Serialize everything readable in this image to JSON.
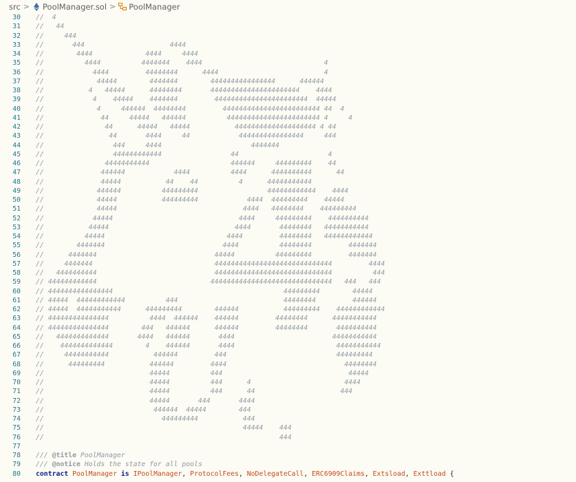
{
  "breadcrumb": {
    "root": "src",
    "file": "PoolManager.sol",
    "symbol": "PoolManager",
    "icons": {
      "file": "ethereum-icon",
      "symbol": "symbol-class-icon"
    }
  },
  "art_lines": [
    {
      "n": "30",
      "t": "//  4"
    },
    {
      "n": "31",
      "t": "//   44"
    },
    {
      "n": "32",
      "t": "//     444"
    },
    {
      "n": "33",
      "t": "//       444                     4444"
    },
    {
      "n": "34",
      "t": "//        4444             4444     4444"
    },
    {
      "n": "35",
      "t": "//          4444          4444444    4444                              4"
    },
    {
      "n": "36",
      "t": "//            4444         44444444      4444                          4"
    },
    {
      "n": "37",
      "t": "//             44444        4444444        4444444444444444      444444"
    },
    {
      "n": "38",
      "t": "//           4   44444      44444444       4444444444444444444444    4444"
    },
    {
      "n": "39",
      "t": "//            4    44444    4444444         44444444444444444444444  44444"
    },
    {
      "n": "40",
      "t": "//             4     444444  44444444         444444444444444444444444 44  4"
    },
    {
      "n": "41",
      "t": "//              44     44444   444444          44444444444444444444444 4     4"
    },
    {
      "n": "42",
      "t": "//               44      44444   44444           44444444444444444444 4 44"
    },
    {
      "n": "43",
      "t": "//                44       4444     44            4444444444444444     444"
    },
    {
      "n": "44",
      "t": "//                 444     4444                      4444444"
    },
    {
      "n": "45",
      "t": "//                 444444444444                 44                      4"
    },
    {
      "n": "46",
      "t": "//               44444444444                    444444     444444444    44"
    },
    {
      "n": "47",
      "t": "//              444444            4444          4444      4444444444      44"
    },
    {
      "n": "48",
      "t": "//              44444           44    44          4      44444444444"
    },
    {
      "n": "49",
      "t": "//             444444          444444444                 444444444444    4444"
    },
    {
      "n": "50",
      "t": "//             44444           444444444            4444  444444444    44444"
    },
    {
      "n": "51",
      "t": "//             44444                               4444   44444444    444444444"
    },
    {
      "n": "52",
      "t": "//            44444                               4444     444444444    4444444444"
    },
    {
      "n": "53",
      "t": "//           44444                               4444       44444444   44444444444"
    },
    {
      "n": "54",
      "t": "//          44444                              4444         44444444   444444444444"
    },
    {
      "n": "55",
      "t": "//        4444444                             4444          44444444         4444444"
    },
    {
      "n": "56",
      "t": "//      4444444                             44444          444444444         4444444"
    },
    {
      "n": "57",
      "t": "//     4444444                              44444444444444444444444444444         4444"
    },
    {
      "n": "58",
      "t": "//   4444444444                             44444444444444444444444444444          444"
    },
    {
      "n": "59",
      "t": "// 444444444444                            444444444444444444444444444444   444   444"
    },
    {
      "n": "60",
      "t": "// 4444444444444444                                          444444444        44444"
    },
    {
      "n": "61",
      "t": "// 44444  444444444444          444                          44444444         444444"
    },
    {
      "n": "62",
      "t": "// 44444  44444444444      444444444        444444           444444444    444444444444"
    },
    {
      "n": "63",
      "t": "// 444444444444444          4444  444444    444444         44444444      44444444444"
    },
    {
      "n": "64",
      "t": "// 444444444444444        444   444444      444444         44444444       4444444444"
    },
    {
      "n": "65",
      "t": "//   4444444444444       4444   444444       4444                        44444444444"
    },
    {
      "n": "66",
      "t": "//    4444444444444        4    444444       4444                         44444444444"
    },
    {
      "n": "67",
      "t": "//     44444444444           444444         444                           444444444"
    },
    {
      "n": "68",
      "t": "//      444444444           444444         4444                             44444444"
    },
    {
      "n": "69",
      "t": "//                          44444          444                               44444"
    },
    {
      "n": "70",
      "t": "//                          44444          444      4                       4444"
    },
    {
      "n": "71",
      "t": "//                          44444          444      44                     444"
    },
    {
      "n": "72",
      "t": "//                          44444       444       4444"
    },
    {
      "n": "73",
      "t": "//                           444444  44444        444"
    },
    {
      "n": "74",
      "t": "//                             444444444           444"
    },
    {
      "n": "75",
      "t": "//                                                 44444    444"
    },
    {
      "n": "76",
      "t": "//                                                          444"
    },
    {
      "n": "77",
      "t": ""
    }
  ],
  "doc": {
    "line78": {
      "n": "78",
      "prefix": "/// ",
      "tag": "@title",
      "text": " PoolManager"
    },
    "line79": {
      "n": "79",
      "prefix": "/// ",
      "tag": "@notice",
      "text": " Holds the state for all pools"
    }
  },
  "contract_line": {
    "n": "80",
    "kw_contract": "contract",
    "name": "PoolManager",
    "kw_is": "is",
    "bases": [
      "IPoolManager",
      "ProtocolFees",
      "NoDelegateCall",
      "ERC6909Claims",
      "Extsload",
      "Exttload"
    ],
    "brace": "{"
  }
}
